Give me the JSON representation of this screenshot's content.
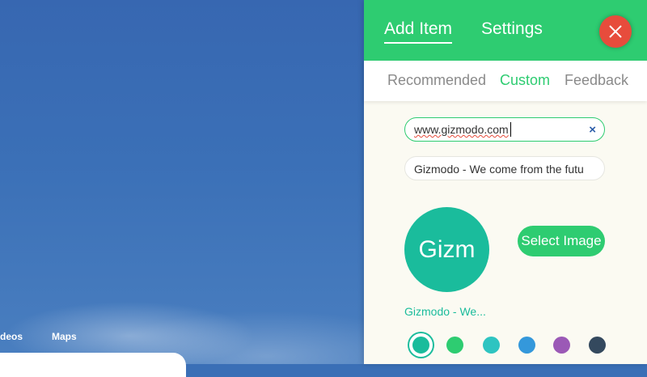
{
  "background": {
    "nav": [
      "deos",
      "Maps"
    ]
  },
  "panel": {
    "tabs": {
      "add_item": "Add Item",
      "settings": "Settings"
    },
    "subtabs": {
      "recommended": "Recommended",
      "custom": "Custom",
      "feedback": "Feedback"
    },
    "url_field": {
      "value": "www.gizmodo.com",
      "clear_icon": "×"
    },
    "title_field": {
      "value": "Gizmodo - We come from the futu"
    },
    "preview": {
      "circle_text": "Gizm",
      "label": "Gizmodo - We..."
    },
    "select_image_label": "Select Image",
    "swatches": [
      "#1abc9c",
      "#2ecc71",
      "#2ec4c1",
      "#3498db",
      "#9b59b6",
      "#34495e"
    ],
    "colors": {
      "accent": "#2ecc71",
      "close": "#e74c3c",
      "background_blue": "#3a6fb6"
    }
  }
}
